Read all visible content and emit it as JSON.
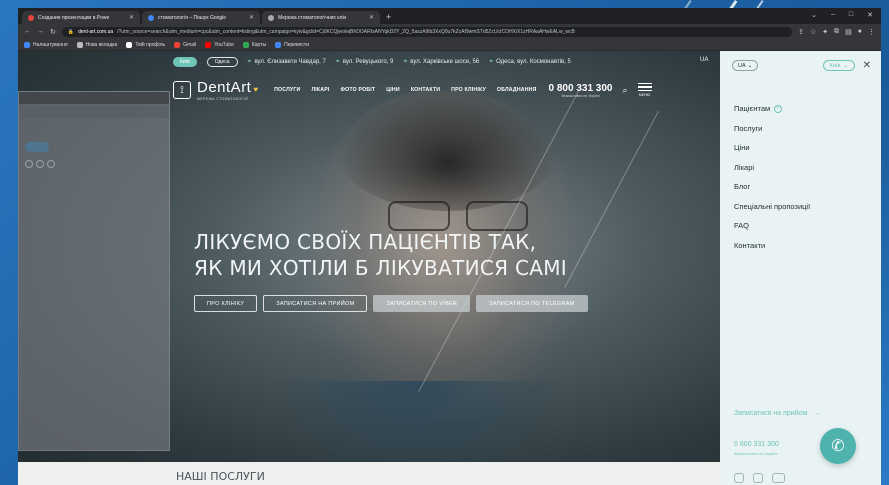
{
  "browser": {
    "tabs": [
      {
        "label": "Создание презентации в Powe",
        "color": "#e8453c"
      },
      {
        "label": "стоматологія – Пошук Google",
        "color": "#4285f4"
      },
      {
        "label": "Мережа стоматологічних клін",
        "color": "#aaaaaa"
      }
    ],
    "url_host": "dent-art.com.ua",
    "url_rest": "/?utm_source=search&utm_medium=cpc&utm_content=listing&utm_campaign=kyiv&gclid=Cj0KCQjwoIejBhDOARIsANYqkD2Y_2Q_5aszAl6b3XxQ0u7kZcAf9wmSTd5ZcUcICOHXiX1zHRAaAHwEALw_wcB",
    "bookmarks": [
      {
        "label": "Налаштування",
        "color": "#4285f4"
      },
      {
        "label": "Нова вкладка",
        "color": "#bbbbbb"
      },
      {
        "label": "Твій профіль",
        "color": "#ffffff"
      },
      {
        "label": "Gmail",
        "color": "#ea4335"
      },
      {
        "label": "YouTube",
        "color": "#ff0000"
      },
      {
        "label": "Карты",
        "color": "#34a853"
      },
      {
        "label": "Перевести",
        "color": "#4285f4"
      }
    ]
  },
  "site": {
    "cities": {
      "active": "Київ",
      "other": "Одеса"
    },
    "addresses": [
      "вул. Єлизавети Чавдар, 7",
      "вул. Ревуцького, 9",
      "вул. Харківське шосе, 56",
      "Одеса, вул. Космонавтів, 5"
    ],
    "lang": "UA",
    "logo_text": "DentArt",
    "logo_sub": "МЕРЕЖА СТОМАТОЛОГІЙ",
    "nav": [
      "ПОСЛУГИ",
      "ЛІКАРІ",
      "ФОТО РОБІТ",
      "ЦІНИ",
      "КОНТАКТИ",
      "ПРО КЛІНІКУ",
      "ОБЛАДНАННЯ"
    ],
    "phone": "0 800 331 300",
    "phone_sub": "безкоштовно по Україні",
    "menu_label": "МЕНЮ",
    "hero_line1": "ЛІКУЄМО СВОЇХ ПАЦІЄНТІВ ТАК,",
    "hero_line2": "ЯК МИ ХОТІЛИ Б ЛІКУВАТИСЯ САМІ",
    "buttons": [
      "ПРО КЛІНІКУ",
      "ЗАПИСАТИСЯ НА ПРИЙОМ",
      "ЗАПИСАТИСЯ ПО VIBER",
      "ЗАПИСАТИСЯ ПО TELEGRAM"
    ],
    "services_title": "НАШІ ПОСЛУГИ"
  },
  "panel": {
    "lang": "UA",
    "city": "Київ",
    "menu": [
      "Пацієнтам",
      "Послуги",
      "Ціни",
      "Лікарі",
      "Блог",
      "Спеціальні пропозиції",
      "FAQ",
      "Контакти"
    ],
    "book": "Записатися на прийом",
    "phone": "0 800 331 300",
    "phone_sub": "безкоштовно по Україні"
  }
}
